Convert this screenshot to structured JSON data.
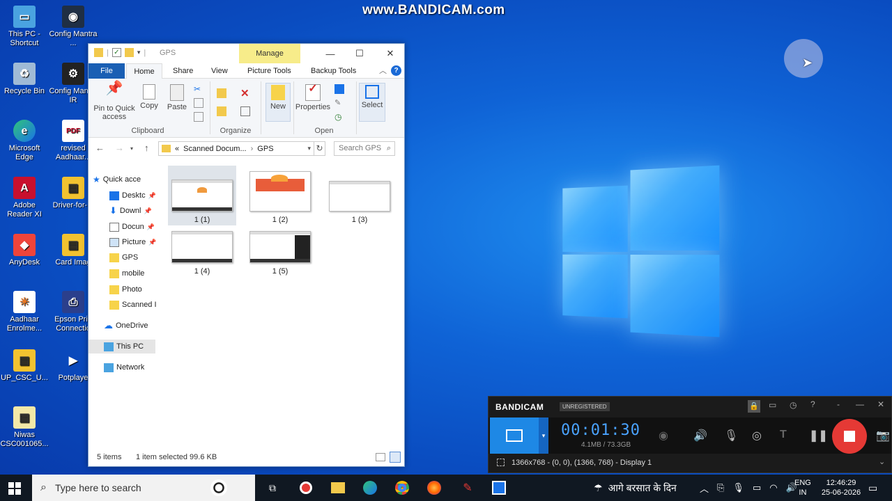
{
  "watermark": "www.BANDICAM.com",
  "desktop_icons": [
    {
      "label": "This PC - Shortcut"
    },
    {
      "label": "Config Mantra ..."
    },
    {
      "label": "Recycle Bin"
    },
    {
      "label": "Config Mantra IR"
    },
    {
      "label": "Microsoft Edge"
    },
    {
      "label": "revised Aadhaar..."
    },
    {
      "label": "Adobe Reader XI"
    },
    {
      "label": "Driver-for-..."
    },
    {
      "label": "AnyDesk"
    },
    {
      "label": "Card Imag"
    },
    {
      "label": "Aadhaar Enrolme..."
    },
    {
      "label": "Epson Prin Connectio"
    },
    {
      "label": "UP_CSC_U..."
    },
    {
      "label": "Potplaye"
    },
    {
      "label": "Niwas CSC001065..."
    }
  ],
  "explorer": {
    "title": "GPS",
    "manage_label": "Manage",
    "tabs": {
      "file": "File",
      "home": "Home",
      "share": "Share",
      "view": "View",
      "picture_tools": "Picture Tools",
      "backup_tools": "Backup Tools"
    },
    "ribbon": {
      "pin_label": "Pin to Quick access",
      "copy_label": "Copy",
      "paste_label": "Paste",
      "clipboard_group": "Clipboard",
      "organize_group": "Organize",
      "new_label": "New",
      "properties_label": "Properties",
      "open_group": "Open",
      "select_label": "Select"
    },
    "address": {
      "prefix": "«",
      "crumb1": "Scanned Docum...",
      "sep": "›",
      "crumb2": "GPS"
    },
    "search_placeholder": "Search GPS",
    "nav": {
      "quick_access": "Quick acce",
      "desktop": "Desktc",
      "downloads": "Downl",
      "documents": "Docun",
      "pictures": "Picture",
      "gps": "GPS",
      "mobile": "mobile",
      "photo": "Photo",
      "scanned": "Scanned I",
      "onedrive": "OneDrive",
      "thispc": "This PC",
      "network": "Network"
    },
    "files": [
      "1 (1)",
      "1 (2)",
      "1 (3)",
      "1 (4)",
      "1 (5)"
    ],
    "status": {
      "count": "5 items",
      "selected": "1 item selected  99.6 KB"
    }
  },
  "bandicam": {
    "logo": "BANDICAM",
    "unregistered": "UNREGISTERED",
    "time": "00:01:30",
    "size": "4.1MB / 73.3GB",
    "capture_info": "1366x768 - (0, 0), (1366, 768) - Display 1"
  },
  "taskbar": {
    "search_placeholder": "Type here to search",
    "weather": "आगे बरसात के दिन",
    "lang_top": "ENG",
    "lang_bottom": "IN",
    "time": "12:46:29",
    "date": "25-06-2026"
  }
}
